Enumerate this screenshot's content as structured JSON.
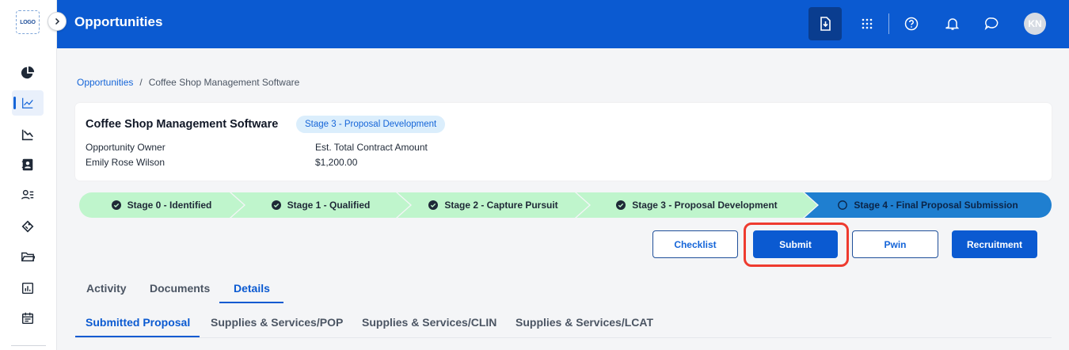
{
  "sidebar": {
    "logo_text": "LOGO",
    "items": [
      {
        "icon": "pie-chart-icon"
      },
      {
        "icon": "line-chart-icon",
        "active": true
      },
      {
        "icon": "trend-down-icon"
      },
      {
        "icon": "contact-card-icon"
      },
      {
        "icon": "people-list-icon"
      },
      {
        "icon": "tag-icon"
      },
      {
        "icon": "folder-icon"
      },
      {
        "icon": "bar-report-icon"
      },
      {
        "icon": "calendar-icon"
      }
    ]
  },
  "header": {
    "title": "Opportunities",
    "avatar_initials": "KN"
  },
  "breadcrumb": {
    "root": "Opportunities",
    "separator": "/",
    "current": "Coffee Shop Management Software"
  },
  "opportunity": {
    "title": "Coffee Shop Management Software",
    "stage_badge": "Stage 3 - Proposal Development",
    "owner_label": "Opportunity Owner",
    "owner_value": "Emily Rose Wilson",
    "amount_label": "Est. Total Contract Amount",
    "amount_value": "$1,200.00"
  },
  "stages": [
    {
      "label": "Stage 0 - Identified",
      "status": "done"
    },
    {
      "label": "Stage 1 - Qualified",
      "status": "done"
    },
    {
      "label": "Stage 2 - Capture Pursuit",
      "status": "done"
    },
    {
      "label": "Stage 3 - Proposal Development",
      "status": "done"
    },
    {
      "label": "Stage 4 - Final Proposal Submission",
      "status": "current"
    }
  ],
  "actions": {
    "checklist": "Checklist",
    "submit": "Submit",
    "pwin": "Pwin",
    "recruitment": "Recruitment"
  },
  "tabs": {
    "primary": [
      "Activity",
      "Documents",
      "Details"
    ],
    "primary_active": "Details",
    "secondary": [
      "Submitted Proposal",
      "Supplies & Services/POP",
      "Supplies & Services/CLIN",
      "Supplies & Services/LCAT"
    ],
    "secondary_active": "Submitted Proposal"
  },
  "colors": {
    "header": "#0b5ad1",
    "stage_done": "#bff5cc",
    "stage_current": "#1f7fd0",
    "highlight": "#ee3b2f"
  }
}
